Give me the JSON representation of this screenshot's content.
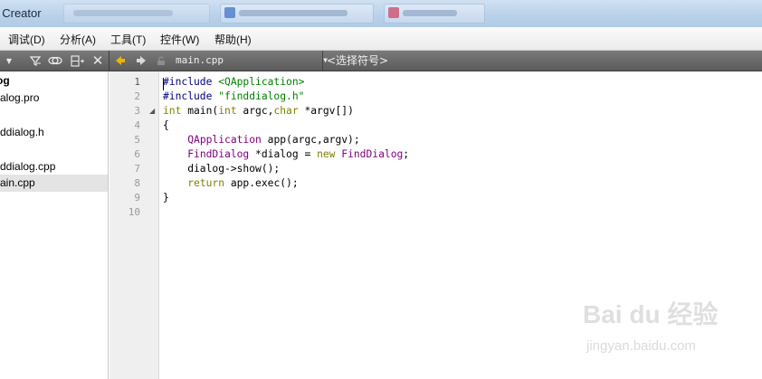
{
  "window": {
    "title": "t Creator"
  },
  "menubar": {
    "items": [
      "调试(D)",
      "分析(A)",
      "工具(T)",
      "控件(W)",
      "帮助(H)"
    ]
  },
  "left_toolbar": {
    "icons": [
      "filter-icon",
      "link-icon",
      "split-icon",
      "close-icon"
    ]
  },
  "editor_toolbar": {
    "file_combo": "main.cpp",
    "symbol_combo": "<选择符号>"
  },
  "project_tree": {
    "items": [
      {
        "label": "og",
        "bold": true,
        "selected": false
      },
      {
        "label": "alog.pro",
        "bold": false,
        "selected": false
      },
      {
        "label": "r",
        "bold": false,
        "selected": false
      },
      {
        "label": "ddialog.h",
        "bold": false,
        "selected": false
      },
      {
        "label": "r",
        "bold": false,
        "selected": false
      },
      {
        "label": "ddialog.cpp",
        "bold": false,
        "selected": false
      },
      {
        "label": "ain.cpp",
        "bold": false,
        "selected": true
      }
    ]
  },
  "editor": {
    "line_numbers": [
      "1",
      "2",
      "3",
      "4",
      "5",
      "6",
      "7",
      "8",
      "9",
      "10"
    ],
    "current_line": "1",
    "lines": [
      [
        {
          "t": "#include ",
          "c": "pre"
        },
        {
          "t": "<QApplication>",
          "c": "str"
        }
      ],
      [
        {
          "t": "#include ",
          "c": "pre"
        },
        {
          "t": "\"finddialog.h\"",
          "c": "str"
        }
      ],
      [
        {
          "t": "int",
          "c": "kw"
        },
        {
          "t": " main(",
          "c": ""
        },
        {
          "t": "int",
          "c": "kw"
        },
        {
          "t": " argc,",
          "c": ""
        },
        {
          "t": "char",
          "c": "kw"
        },
        {
          "t": " *argv[])",
          "c": ""
        }
      ],
      [
        {
          "t": "{",
          "c": ""
        }
      ],
      [
        {
          "t": "    ",
          "c": ""
        },
        {
          "t": "QApplication",
          "c": "type"
        },
        {
          "t": " app(argc,argv);",
          "c": ""
        }
      ],
      [
        {
          "t": "    ",
          "c": ""
        },
        {
          "t": "FindDialog",
          "c": "type"
        },
        {
          "t": " *dialog = ",
          "c": ""
        },
        {
          "t": "new",
          "c": "kw"
        },
        {
          "t": " ",
          "c": ""
        },
        {
          "t": "FindDialog",
          "c": "type"
        },
        {
          "t": ";",
          "c": ""
        }
      ],
      [
        {
          "t": "    dialog->show();",
          "c": ""
        }
      ],
      [
        {
          "t": "    ",
          "c": ""
        },
        {
          "t": "return",
          "c": "kw"
        },
        {
          "t": " app.exec();",
          "c": ""
        }
      ],
      [
        {
          "t": "}",
          "c": ""
        }
      ],
      []
    ]
  },
  "watermark": {
    "logo": "Bai du 经验",
    "url": "jingyan.baidu.com"
  },
  "colors": {
    "preprocessor": "#000080",
    "string": "#008000",
    "keyword": "#808000",
    "type": "#800080",
    "toolbar": "#6a6a6a",
    "arrow_back": "#f0b400"
  }
}
